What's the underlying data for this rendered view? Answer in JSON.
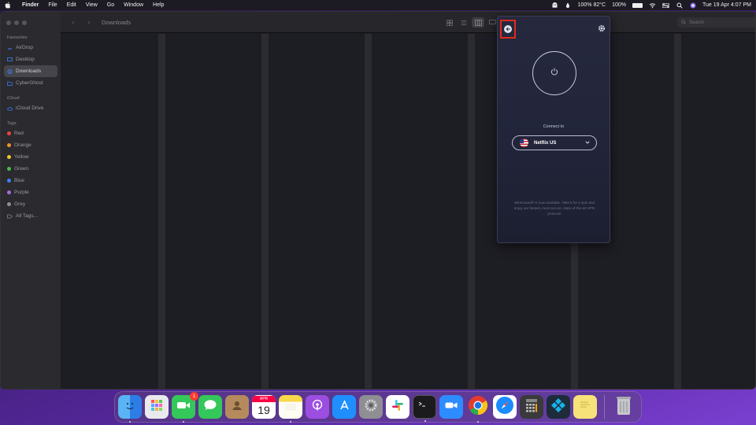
{
  "menubar": {
    "app_name": "Finder",
    "menus": [
      "File",
      "Edit",
      "View",
      "Go",
      "Window",
      "Help"
    ],
    "battery_temp": "100% 82°C",
    "battery_pct": "100%",
    "datetime": "Tue 19 Apr  4:07 PM"
  },
  "sidebar": {
    "favourites_header": "Favourites",
    "favourites": [
      "AirDrop",
      "Desktop",
      "Downloads",
      "CyberGhost"
    ],
    "icloud_header": "iCloud",
    "icloud": [
      "iCloud Drive"
    ],
    "tags_header": "Tags",
    "tags": [
      {
        "label": "Red",
        "color": "#e8453c"
      },
      {
        "label": "Orange",
        "color": "#f0922b"
      },
      {
        "label": "Yellow",
        "color": "#e9c82d"
      },
      {
        "label": "Green",
        "color": "#4cba4c"
      },
      {
        "label": "Blue",
        "color": "#3b82f6"
      },
      {
        "label": "Purple",
        "color": "#a56bd9"
      },
      {
        "label": "Grey",
        "color": "#8e8e93"
      }
    ],
    "all_tags": "All Tags..."
  },
  "toolbar": {
    "title": "Downloads",
    "search_placeholder": "Search"
  },
  "vpn": {
    "connect_label": "Connect to",
    "server": "Netflix US",
    "info_text": "WireGuard® is now available. Take it for a spin and enjoy our fastest, most secure, state-of-the-art VPN protocol!",
    "highlight_color": "#e02a1b"
  },
  "dock": {
    "apps": [
      "Finder",
      "Launchpad",
      "FaceTime",
      "Messages",
      "Contacts",
      "Calendar",
      "Notes",
      "Podcasts",
      "App Store",
      "System Preferences",
      "Slack",
      "Terminal",
      "Zoom",
      "Chrome",
      "Safari",
      "Calculator",
      "Kodi",
      "Stickies",
      "Trash"
    ],
    "facetime_badge": "1",
    "calendar_month": "APR",
    "calendar_day": "19"
  }
}
